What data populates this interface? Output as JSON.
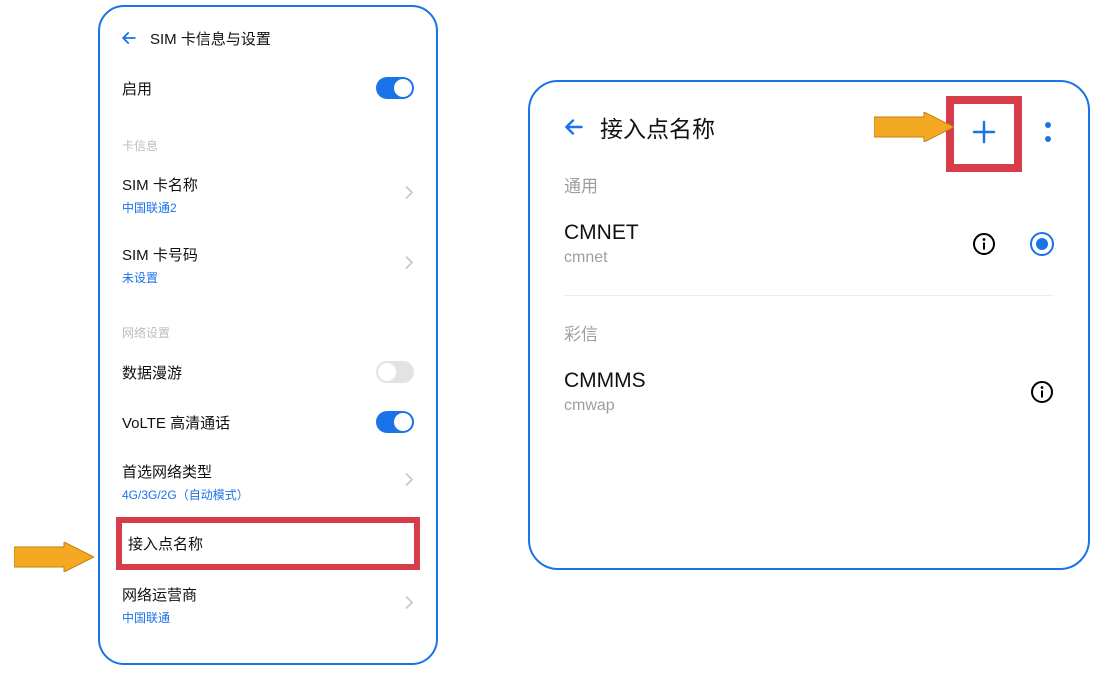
{
  "left": {
    "title": "SIM 卡信息与设置",
    "enable_label": "启用",
    "section_card": "卡信息",
    "sim_name_label": "SIM 卡名称",
    "sim_name_value": "中国联通2",
    "sim_number_label": "SIM 卡号码",
    "sim_number_value": "未设置",
    "section_net": "网络设置",
    "roaming_label": "数据漫游",
    "volte_label": "VoLTE 高清通话",
    "pref_net_label": "首选网络类型",
    "pref_net_value": "4G/3G/2G（自动模式）",
    "apn_label": "接入点名称",
    "carrier_label": "网络运营商",
    "carrier_value": "中国联通"
  },
  "right": {
    "title": "接入点名称",
    "section_general": "通用",
    "apn1_name": "CMNET",
    "apn1_sub": "cmnet",
    "section_mms": "彩信",
    "apn2_name": "CMMMS",
    "apn2_sub": "cmwap"
  }
}
